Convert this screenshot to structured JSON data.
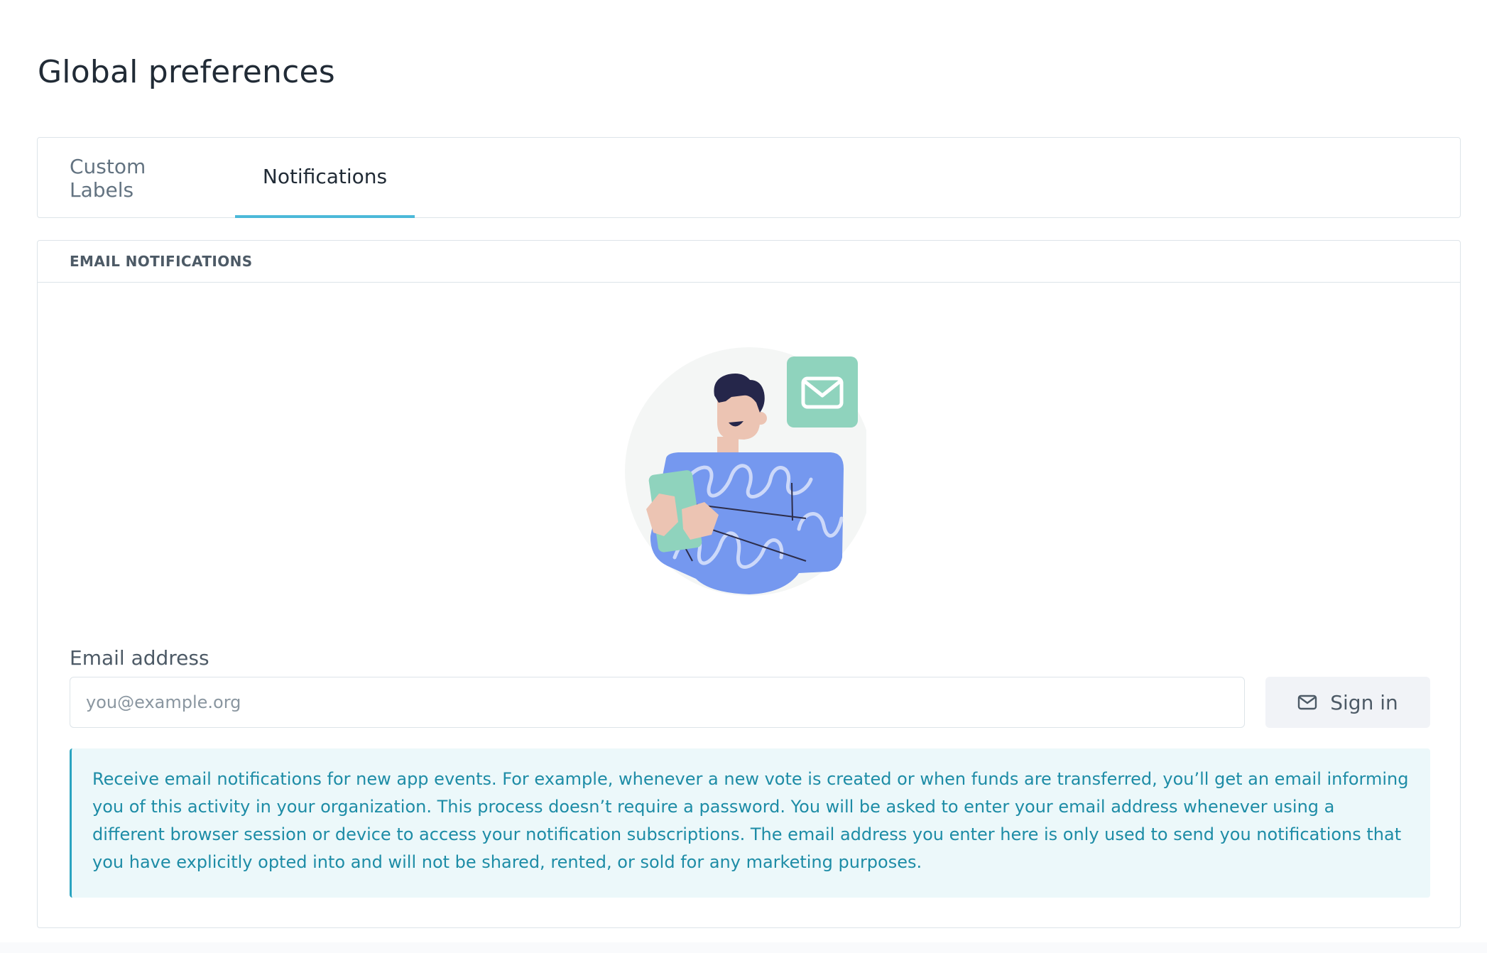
{
  "page": {
    "title": "Global preferences"
  },
  "tabs": [
    {
      "label": "Custom Labels",
      "active": false
    },
    {
      "label": "Notifications",
      "active": true
    }
  ],
  "email_notifications": {
    "section_title": "EMAIL NOTIFICATIONS",
    "illustration": "person-with-email-illustration",
    "email_label": "Email address",
    "email_placeholder": "you@example.org",
    "email_value": "",
    "sign_in_label": "Sign in",
    "sign_in_icon": "envelope-icon",
    "info_text": "Receive email notifications for new app events. For example, whenever a new vote is created or when funds are transferred, you’ll get an email informing you of this activity in your organization. This process doesn’t require a password. You will be asked to enter your email address whenever using a different browser session or device to access your notification subscriptions. The email address you enter here is only used to send you notifications that you have explicitly opted into and will not be shared, rented, or sold for any marketing purposes."
  },
  "colors": {
    "tab_active_underline": "#4bb9d9",
    "info_background": "#ecf8fa",
    "info_text": "#1d8ca6",
    "info_border": "#2aa4c0",
    "envelope_badge": "#8fd3bd",
    "shirt": "#7598ef"
  }
}
